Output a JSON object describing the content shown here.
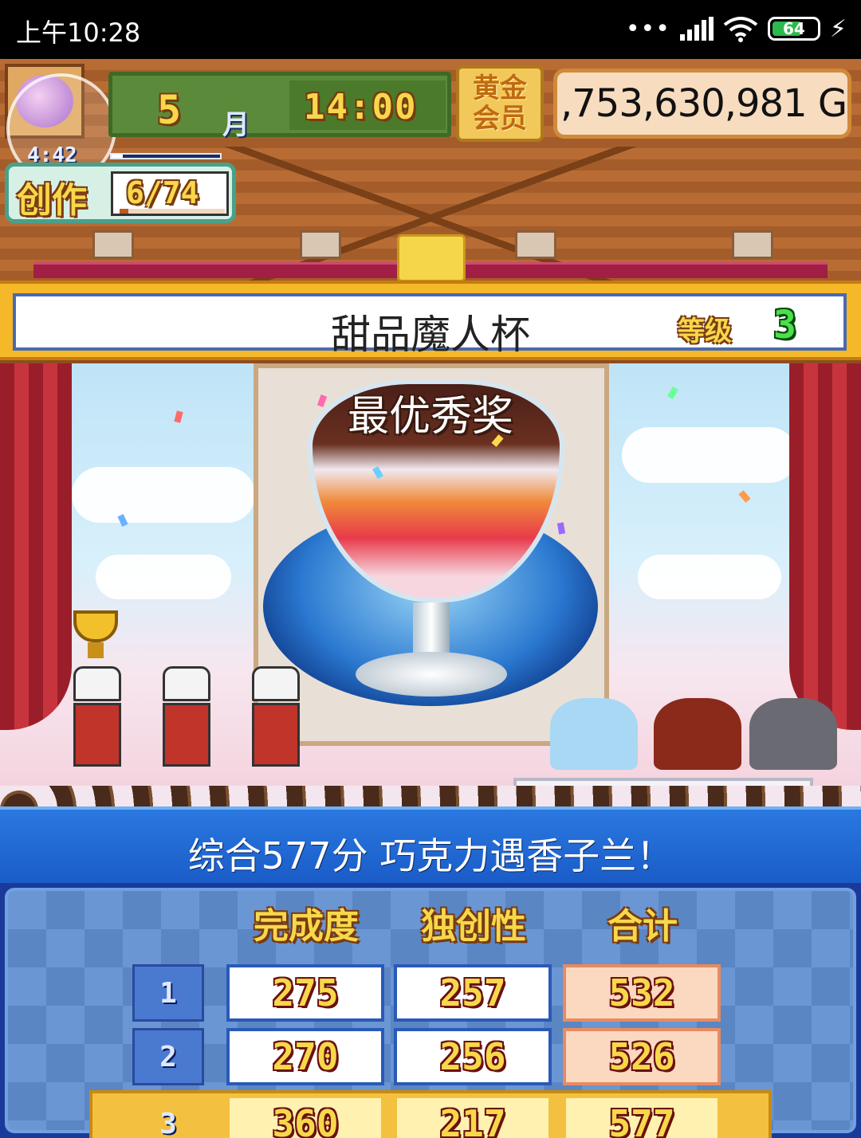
{
  "status_bar": {
    "time": "上午10:28",
    "signal_dots": "•••",
    "battery": "64"
  },
  "hud": {
    "month": "5",
    "month_unit": "月",
    "clock": "14:00",
    "member_label": "黄金会员",
    "gold": ",753,630,981 G",
    "timer": "4:42",
    "create_label": "创作",
    "create_value": "6/74"
  },
  "contest": {
    "name": "甜品魔人杯",
    "grade_label": "等级",
    "grade_value": "3",
    "award": "最优秀奖"
  },
  "result_message": "综合577分 巧克力遇香子兰！",
  "score_table": {
    "headers": [
      "完成度",
      "独创性",
      "合计"
    ],
    "rows": [
      {
        "rank": "1",
        "completion": "275",
        "originality": "257",
        "total": "532"
      },
      {
        "rank": "2",
        "completion": "270",
        "originality": "256",
        "total": "526"
      },
      {
        "rank": "3",
        "completion": "360",
        "originality": "217",
        "total": "577"
      }
    ],
    "highlight_row": 3
  },
  "colors": {
    "accent_gold": "#f6d84a",
    "message_blue": "#1a5cc8",
    "grade_green": "#4ae04a"
  },
  "icons": [
    "wifi-icon",
    "signal-icon",
    "battery-icon",
    "charging-bolt-icon",
    "avatar-icon",
    "trophy-icon"
  ]
}
